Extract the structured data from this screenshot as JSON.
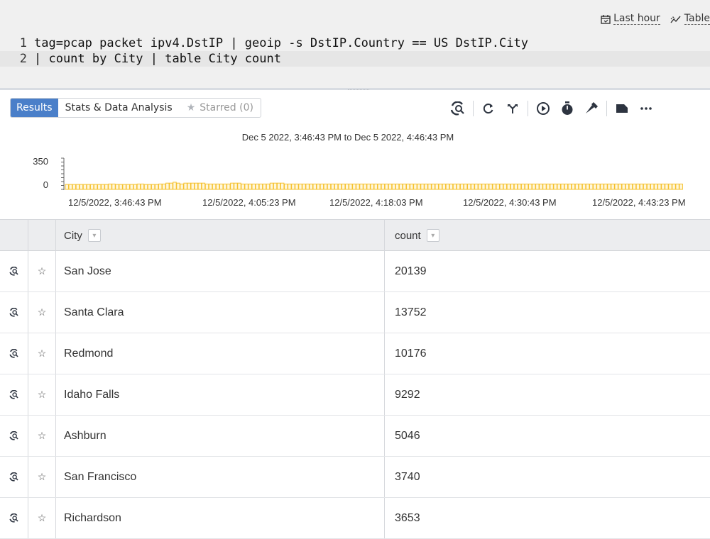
{
  "header": {
    "time_range_label": "Last hour",
    "view_label": "Table"
  },
  "editor": {
    "lines": [
      {
        "number": "1",
        "text": "tag=pcap packet ipv4.DstIP | geoip -s DstIP.Country == US DstIP.City"
      },
      {
        "number": "2",
        "text": "| count by City | table City count"
      }
    ]
  },
  "tabs": {
    "results": "Results",
    "stats": "Stats & Data Analysis",
    "starred": "Starred (0)"
  },
  "toolbar": {
    "icons": [
      "search-scope-icon",
      "refresh-icon",
      "fork-icon",
      "play-icon",
      "timer-icon",
      "hammer-icon",
      "label-icon",
      "more-icon"
    ]
  },
  "histogram": {
    "title": "Dec 5 2022, 3:46:43 PM to Dec 5 2022, 4:46:43 PM",
    "y_ticks": [
      "350",
      "0"
    ],
    "x_ticks": [
      "12/5/2022, 3:46:43 PM",
      "12/5/2022, 4:05:23 PM",
      "12/5/2022, 4:18:03 PM",
      "12/5/2022, 4:30:43 PM",
      "12/5/2022, 4:43:23 PM"
    ],
    "bar_color": "#f5c12e"
  },
  "chart_data": {
    "type": "bar",
    "title": "Dec 5 2022, 3:46:43 PM to Dec 5 2022, 4:46:43 PM",
    "ylim": [
      0,
      350
    ],
    "values": [
      55,
      55,
      55,
      55,
      55,
      55,
      55,
      55,
      55,
      55,
      55,
      55,
      60,
      60,
      55,
      55,
      55,
      55,
      55,
      55,
      60,
      60,
      55,
      55,
      55,
      55,
      60,
      60,
      70,
      70,
      80,
      70,
      60,
      70,
      70,
      70,
      70,
      70,
      70,
      60,
      60,
      60,
      60,
      60,
      60,
      60,
      70,
      70,
      70,
      60,
      60,
      60,
      60,
      60,
      60,
      60,
      60,
      70,
      70,
      70,
      70,
      60,
      60,
      60,
      60,
      60,
      60,
      60,
      60,
      60,
      60,
      60,
      60,
      60,
      60,
      60,
      60,
      60,
      60,
      60,
      60,
      60,
      60,
      60,
      60,
      60,
      60,
      60,
      60,
      60,
      60,
      60,
      60,
      60,
      60,
      60,
      60,
      60,
      60,
      60,
      60,
      60,
      60,
      60,
      60,
      60,
      60,
      60,
      60,
      60,
      60,
      60,
      60,
      60,
      60,
      60,
      60,
      60,
      60,
      60,
      60,
      60,
      60,
      60,
      60,
      60,
      60,
      60,
      60,
      60,
      60,
      60,
      60,
      60,
      60,
      60,
      60,
      60,
      60,
      60,
      60,
      60,
      60,
      60,
      60,
      60,
      60,
      60,
      60,
      60,
      60,
      60,
      60,
      60,
      60,
      60,
      60,
      60,
      60,
      60,
      60,
      60,
      60,
      60,
      60,
      60,
      60,
      60,
      60,
      60,
      60,
      60
    ]
  },
  "table": {
    "columns": [
      "City",
      "count"
    ],
    "rows": [
      {
        "city": "San Jose",
        "count": "20139"
      },
      {
        "city": "Santa Clara",
        "count": "13752"
      },
      {
        "city": "Redmond",
        "count": "10176"
      },
      {
        "city": "Idaho Falls",
        "count": "9292"
      },
      {
        "city": "Ashburn",
        "count": "5046"
      },
      {
        "city": "San Francisco",
        "count": "3740"
      },
      {
        "city": "Richardson",
        "count": "3653"
      }
    ]
  }
}
